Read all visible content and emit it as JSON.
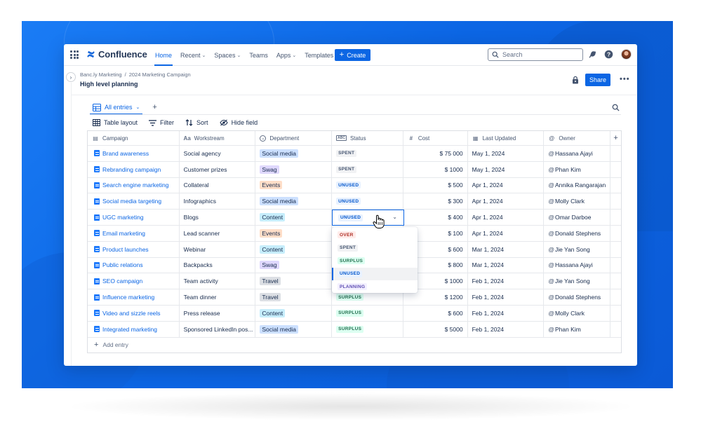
{
  "colors": {
    "accent": "#0c66e4",
    "lozenges": {
      "SPENT": {
        "bg": "#f1f2f4",
        "fg": "#44546f"
      },
      "UNUSED": {
        "bg": "#e9f2ff",
        "fg": "#0055cc"
      },
      "SURPLUS": {
        "bg": "#dcfff1",
        "fg": "#216e4e"
      },
      "OVER": {
        "bg": "#ffecea",
        "fg": "#ae2e24"
      },
      "PLANNING": {
        "bg": "#f3f0ff",
        "fg": "#5e4db2"
      }
    },
    "departments": {
      "Social media": "#cce0ff",
      "Swag": "#dfd8fd",
      "Events": "#fedec8",
      "Content": "#c6edfb",
      "Travel": "#dcdfe4"
    }
  },
  "topnav": {
    "logo": "Confluence",
    "links": [
      {
        "label": "Home",
        "active": true,
        "dropdown": false
      },
      {
        "label": "Recent",
        "active": false,
        "dropdown": true
      },
      {
        "label": "Spaces",
        "active": false,
        "dropdown": true
      },
      {
        "label": "Teams",
        "active": false,
        "dropdown": false
      },
      {
        "label": "Apps",
        "active": false,
        "dropdown": true
      },
      {
        "label": "Templates",
        "active": false,
        "dropdown": false
      }
    ],
    "create_label": "Create",
    "search_placeholder": "Search",
    "icons": [
      "app-switcher-icon",
      "notifications-icon",
      "help-icon",
      "avatar"
    ]
  },
  "page": {
    "breadcrumb": [
      "Banc.ly Marketing",
      "2024 Marketing Campaign"
    ],
    "title": "High level planning",
    "share_label": "Share",
    "more_label": "•••"
  },
  "database": {
    "view_label": "All entries",
    "tools": {
      "layout": "Table layout",
      "filter": "Filter",
      "sort": "Sort",
      "hide": "Hide field"
    },
    "columns": [
      {
        "label": "Campaign",
        "icon": "page-icon"
      },
      {
        "label": "Workstream",
        "icon": "text-icon"
      },
      {
        "label": "Department",
        "icon": "select-icon"
      },
      {
        "label": "Status",
        "icon": "status-icon"
      },
      {
        "label": "Cost",
        "icon": "number-icon"
      },
      {
        "label": "Last Updated",
        "icon": "calendar-icon"
      },
      {
        "label": "Owner",
        "icon": "mention-icon"
      }
    ],
    "rows": [
      {
        "campaign": "Brand awareness",
        "workstream": "Social agency",
        "department": "Social media",
        "status": "SPENT",
        "cost": "$ 75 000",
        "updated": "May 1, 2024",
        "owner": "Hassana Ajayi"
      },
      {
        "campaign": "Rebranding campaign",
        "workstream": "Customer prizes",
        "department": "Swag",
        "status": "SPENT",
        "cost": "$ 1000",
        "updated": "May 1, 2024",
        "owner": "Phan Kim"
      },
      {
        "campaign": "Search engine marketing",
        "workstream": "Collateral",
        "department": "Events",
        "status": "UNUSED",
        "cost": "$ 500",
        "updated": "Apr 1, 2024",
        "owner": "Annika Rangarajan"
      },
      {
        "campaign": "Social media targeting",
        "workstream": "Infographics",
        "department": "Social media",
        "status": "UNUSED",
        "cost": "$ 300",
        "updated": "Apr 1, 2024",
        "owner": "Molly Clark"
      },
      {
        "campaign": "UGC marketing",
        "workstream": "Blogs",
        "department": "Content",
        "status": "UNUSED",
        "cost": "$ 400",
        "updated": "Apr 1, 2024",
        "owner": "Omar Darboe"
      },
      {
        "campaign": "Email marketing",
        "workstream": "Lead scanner",
        "department": "Events",
        "status": "",
        "cost": "$ 100",
        "updated": "Apr 1, 2024",
        "owner": "Donald Stephens"
      },
      {
        "campaign": "Product launches",
        "workstream": "Webinar",
        "department": "Content",
        "status": "",
        "cost": "$ 600",
        "updated": "Mar 1, 2024",
        "owner": "Jie Yan Song"
      },
      {
        "campaign": "Public relations",
        "workstream": "Backpacks",
        "department": "Swag",
        "status": "",
        "cost": "$ 800",
        "updated": "Mar 1, 2024",
        "owner": "Hassana Ajayi"
      },
      {
        "campaign": "SEO campaign",
        "workstream": "Team activity",
        "department": "Travel",
        "status": "",
        "cost": "$ 1000",
        "updated": "Feb 1, 2024",
        "owner": "Jie Yan Song"
      },
      {
        "campaign": "Influence marketing",
        "workstream": "Team dinner",
        "department": "Travel",
        "status": "SURPLUS",
        "cost": "$ 1200",
        "updated": "Feb 1, 2024",
        "owner": "Donald Stephens"
      },
      {
        "campaign": "Video and sizzle reels",
        "workstream": "Press release",
        "department": "Content",
        "status": "SURPLUS",
        "cost": "$ 600",
        "updated": "Feb 1, 2024",
        "owner": "Molly Clark"
      },
      {
        "campaign": "Integrated marketing",
        "workstream": "Sponsored LinkedIn pos...",
        "department": "Social media",
        "status": "SURPLUS",
        "cost": "$ 5000",
        "updated": "Feb 1, 2024",
        "owner": "Phan Kim"
      }
    ],
    "add_entry_label": "Add entry",
    "editing_status": "UNUSED",
    "status_options": [
      "OVER",
      "SPENT",
      "SURPLUS",
      "UNUSED",
      "PLANNING"
    ],
    "selected_option": "UNUSED"
  }
}
